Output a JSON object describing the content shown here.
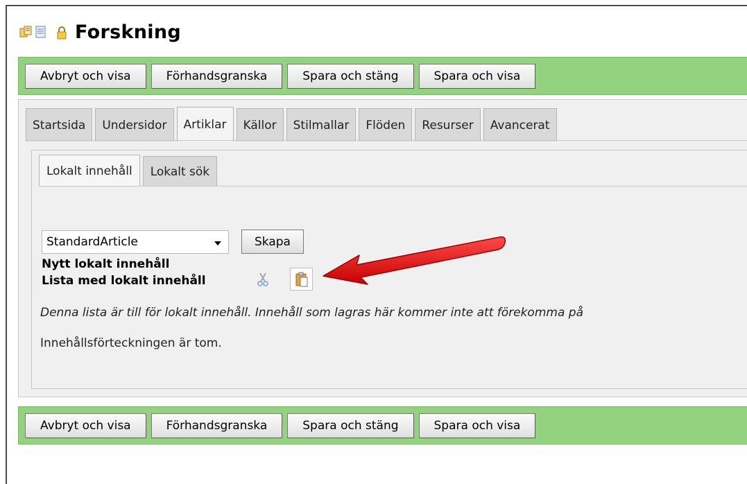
{
  "page": {
    "title": "Forskning"
  },
  "toolbar": {
    "buttons": [
      "Avbryt och visa",
      "Förhandsgranska",
      "Spara och stäng",
      "Spara och visa"
    ]
  },
  "tabs": [
    "Startsida",
    "Undersidor",
    "Artiklar",
    "Källor",
    "Stilmallar",
    "Flöden",
    "Resurser",
    "Avancerat"
  ],
  "active_tab": "Artiklar",
  "subtabs": [
    "Lokalt innehåll",
    "Lokalt sök"
  ],
  "active_subtab": "Lokalt innehåll",
  "content": {
    "new_local_heading": "Nytt lokalt innehåll",
    "select_value": "StandardArticle",
    "create_button": "Skapa",
    "list_heading": "Lista med lokalt innehåll",
    "description": "Denna lista är till för lokalt innehåll. Innehåll som lagras här kommer inte att förekomma på",
    "empty_message": "Innehållsförteckningen är tom."
  },
  "icons": {
    "title_icons": [
      "page-structure-icon",
      "page-properties-icon",
      "lock-icon"
    ],
    "list_icons": [
      "cut-icon",
      "paste-icon"
    ],
    "annotation": "red-arrow-icon"
  },
  "colors": {
    "toolbar_bg": "#93d27f",
    "panel_bg": "#f0f0f0",
    "arrow": "#e61010"
  }
}
